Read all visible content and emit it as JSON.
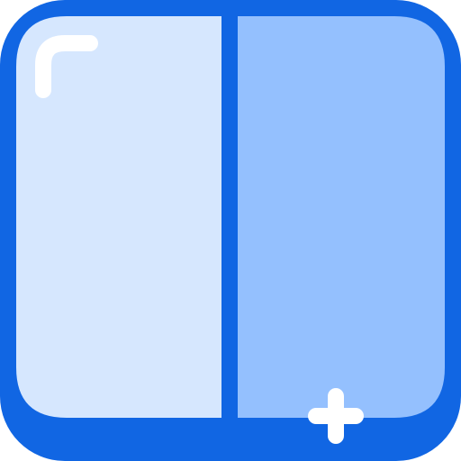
{
  "icon": {
    "name": "split-view-icon",
    "colors": {
      "frame": "#1166E3",
      "left_pane": "#D6E7FE",
      "right_pane": "#94C0FE",
      "highlight": "#FFFFFF",
      "plus": "#FFFFFF"
    }
  }
}
